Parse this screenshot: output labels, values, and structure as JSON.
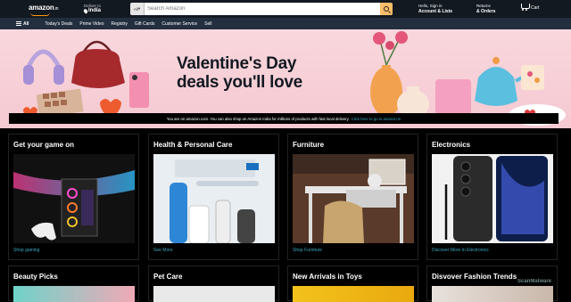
{
  "header": {
    "logo": "amazon",
    "logo_tld": ".in",
    "deliver_label": "Deliver to",
    "deliver_location": "India",
    "search_category": "All",
    "search_placeholder": "Search Amazon",
    "account_line1": "Hello, Sign in",
    "account_line2": "Account & Lists",
    "orders_line1": "Returns",
    "orders_line2": "& Orders",
    "cart_label": "Cart"
  },
  "subnav": {
    "all": "All",
    "items": [
      "Today's Deals",
      "Prime Video",
      "Registry",
      "Gift Cards",
      "Customer Service",
      "Sell"
    ]
  },
  "hero": {
    "title_line1": "Valentine's Day",
    "title_line2": "deals you'll love",
    "notice": "You are on amazon.com. You can also shop on Amazon India for millions of products with fast local delivery.",
    "notice_link": "Click here to go to amazon.in"
  },
  "cards": [
    {
      "title": "Get your game on",
      "link": "Shop gaming"
    },
    {
      "title": "Health & Personal Care",
      "link": "See More"
    },
    {
      "title": "Furniture",
      "link": "Shop Furniture"
    },
    {
      "title": "Electronics",
      "link": "Discover More In Electronics"
    }
  ],
  "cards_row2": [
    {
      "title": "Beauty Picks"
    },
    {
      "title": "Pet Care"
    },
    {
      "title": "New Arrivals in Toys"
    },
    {
      "title": "Disvover Fashion Trends"
    }
  ],
  "watermark": "ScanMalware",
  "colors": {
    "header": "#131921",
    "subnav": "#232f3e",
    "accent": "#febd69",
    "link": "#3aa8c1",
    "hero_bg": "#f6c9d2"
  }
}
